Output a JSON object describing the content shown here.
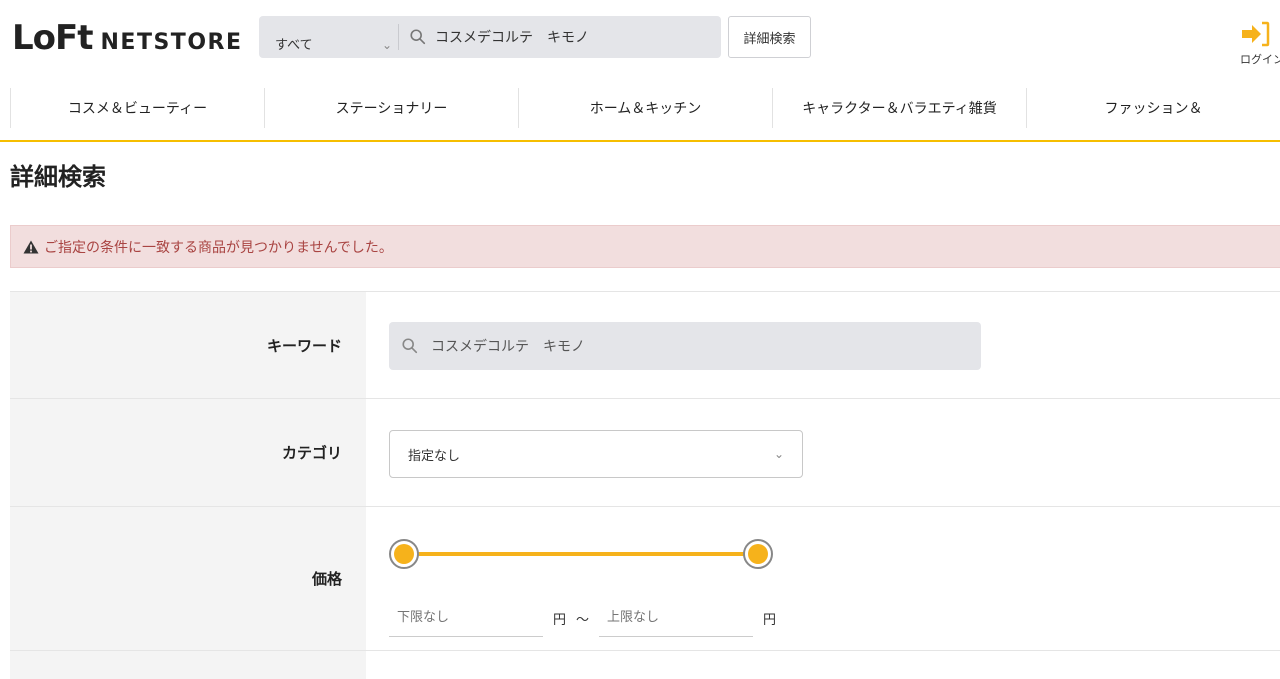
{
  "header": {
    "logo_mark": "LoFt",
    "logo_sub": "NETSTORE",
    "search_scope": "すべて",
    "search_value": "コスメデコルテ　キモノ",
    "detail_search_button": "詳細検索",
    "login_label": "ログイン"
  },
  "nav": {
    "items": [
      {
        "label": "コスメ＆ビューティー"
      },
      {
        "label": "ステーショナリー"
      },
      {
        "label": "ホーム＆キッチン"
      },
      {
        "label": "キャラクター＆バラエティ雑貨"
      },
      {
        "label": "ファッション＆"
      }
    ]
  },
  "page": {
    "title": "詳細検索",
    "alert_message": "ご指定の条件に一致する商品が見つかりませんでした。"
  },
  "form": {
    "keyword_label": "キーワード",
    "keyword_value": "コスメデコルテ　キモノ",
    "category_label": "カテゴリ",
    "category_value": "指定なし",
    "price_label": "価格",
    "price_min_placeholder": "下限なし",
    "price_max_placeholder": "上限なし",
    "yen_unit": "円",
    "range_separator": "～"
  },
  "colors": {
    "accent": "#f6b21b",
    "nav_underline": "#f6be00",
    "alert_bg": "#f2dede",
    "alert_text": "#a94442"
  },
  "icons": {
    "search": "search-icon",
    "login": "login-arrow-icon",
    "warning": "warning-icon",
    "chevron": "chevron-down-icon"
  }
}
